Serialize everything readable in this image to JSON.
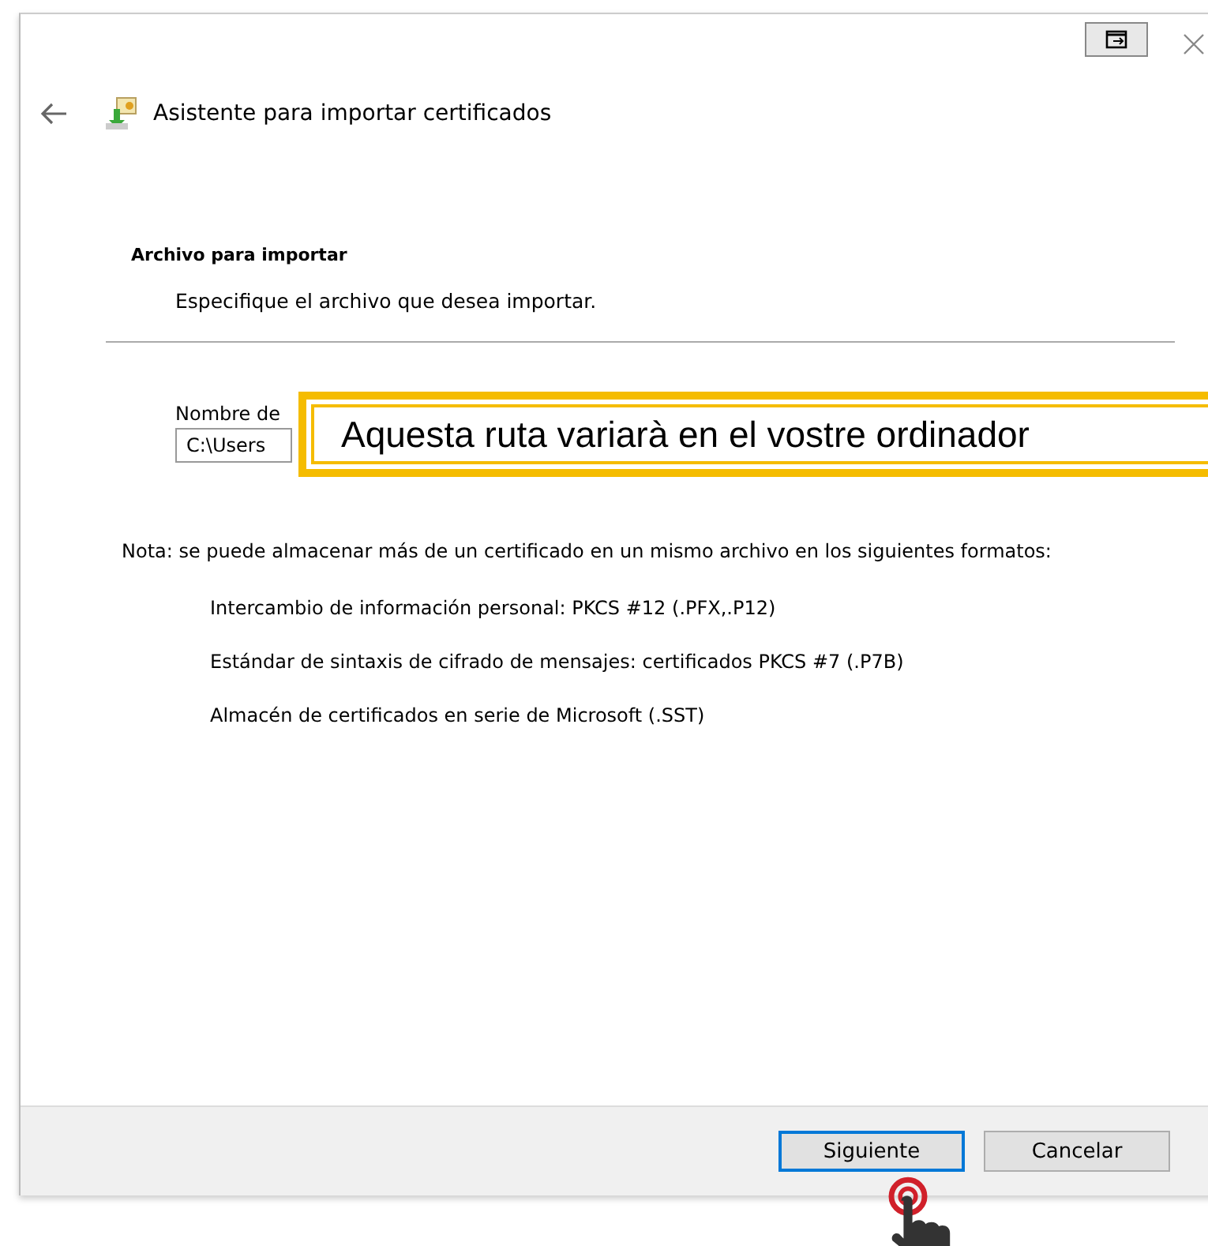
{
  "window": {
    "title": "Asistente para importar certificados"
  },
  "header": {
    "title": "Archivo para importar",
    "subtitle": "Especifique el archivo que desea importar."
  },
  "file": {
    "label": "Nombre de",
    "value": "C:\\Users"
  },
  "callout": {
    "text": "Aquesta ruta variarà en el vostre ordinador"
  },
  "note": "Nota: se puede almacenar más de un certificado en un mismo archivo en los siguientes formatos:",
  "formats": [
    "Intercambio de información personal: PKCS #12 (.PFX,.P12)",
    "Estándar de sintaxis de cifrado de mensajes: certificados PKCS #7 (.P7B)",
    "Almacén de certificados en serie de Microsoft (.SST)"
  ],
  "buttons": [
    {
      "label": "Siguiente",
      "kind": "default"
    },
    {
      "label": "Cancelar",
      "kind": "normal"
    }
  ]
}
